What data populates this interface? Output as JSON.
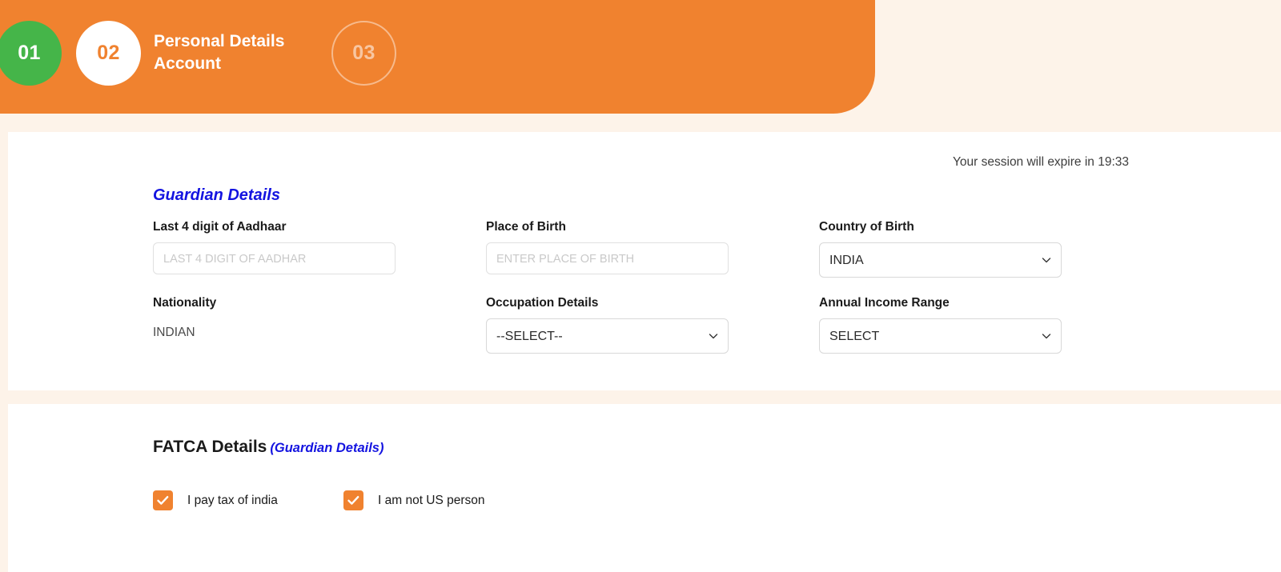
{
  "header": {
    "steps": [
      {
        "number": "01",
        "state": "completed"
      },
      {
        "number": "02",
        "state": "active"
      },
      {
        "number": "03",
        "state": "upcoming"
      }
    ],
    "title_line1": "Personal Details",
    "title_line2": "Account",
    "colors": {
      "banner": "#f0822f",
      "completed": "#45b549",
      "active_text": "#f0822f",
      "upcoming_text": "#ffffff8c"
    }
  },
  "session": {
    "notice": "Your session will expire in 19:33"
  },
  "guardian_section": {
    "title": "Guardian Details",
    "title_color": "#1414e0",
    "fields": {
      "aadhaar": {
        "label": "Last 4 digit of Aadhaar",
        "placeholder": "LAST 4 DIGIT OF AADHAR",
        "value": ""
      },
      "place_of_birth": {
        "label": "Place of Birth",
        "placeholder": "ENTER PLACE OF BIRTH",
        "value": ""
      },
      "country_of_birth": {
        "label": "Country of Birth",
        "selected": "INDIA",
        "icon": "chevron-down-icon"
      },
      "nationality": {
        "label": "Nationality",
        "value": "INDIAN"
      },
      "occupation": {
        "label": "Occupation Details",
        "selected": "--SELECT--",
        "icon": "chevron-down-icon"
      },
      "annual_income": {
        "label": "Annual Income Range",
        "selected": "SELECT",
        "icon": "chevron-down-icon"
      }
    }
  },
  "fatca_section": {
    "title": "FATCA Details",
    "subtitle": "(Guardian Details)",
    "subtitle_color": "#1414e0",
    "checkboxes": [
      {
        "label": "I pay tax of india",
        "checked": true
      },
      {
        "label": "I am not US person",
        "checked": true
      }
    ],
    "checkbox_color": "#f0822f"
  }
}
